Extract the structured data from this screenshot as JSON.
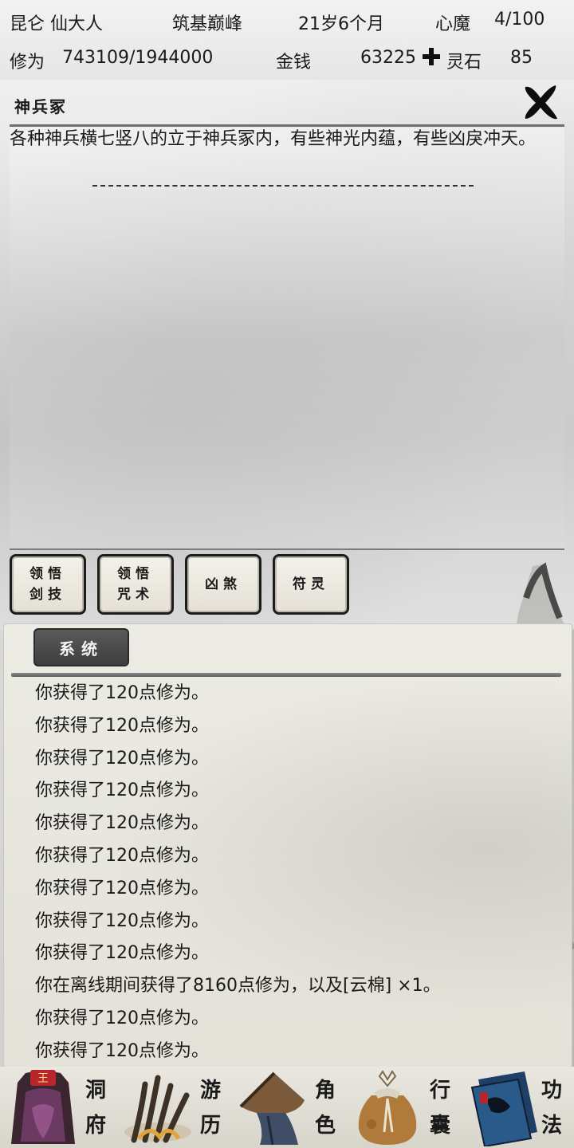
{
  "status": {
    "sect": "昆仑 仙大人",
    "realm": "筑基巅峰",
    "age": "21岁6个月",
    "heart_demon_label": "心魔",
    "heart_demon_value": "4/100",
    "cultivation_label": "修为",
    "cultivation_value": "743109/1944000",
    "money_label": "金钱",
    "money_value": "63225",
    "spirit_stone_label": "灵石",
    "spirit_stone_value": "85"
  },
  "event": {
    "title": "神兵冢",
    "description": "各种神兵横七竖八的立于神兵冢内，有些神光内蕴，有些凶戾冲天。",
    "actions": [
      {
        "line1": "领悟",
        "line2": "剑技"
      },
      {
        "line1": "领悟",
        "line2": "咒术"
      },
      {
        "line1": "凶煞",
        "line2": ""
      },
      {
        "line1": "符灵",
        "line2": ""
      }
    ]
  },
  "log": {
    "tab_label": "系统",
    "entries": [
      "你获得了120点修为。",
      "你获得了120点修为。",
      "你获得了120点修为。",
      "你获得了120点修为。",
      "你获得了120点修为。",
      "你获得了120点修为。",
      "你获得了120点修为。",
      "你获得了120点修为。",
      "你获得了120点修为。",
      "你在离线期间获得了8160点修为，以及[云棉] ×1。",
      "你获得了120点修为。",
      "你获得了120点修为。"
    ]
  },
  "nav": [
    {
      "char1": "洞",
      "char2": "府",
      "icon": "cave-dwelling-icon"
    },
    {
      "char1": "游",
      "char2": "历",
      "icon": "travel-icon"
    },
    {
      "char1": "角",
      "char2": "色",
      "icon": "character-icon"
    },
    {
      "char1": "行",
      "char2": "囊",
      "icon": "bag-icon"
    },
    {
      "char1": "功",
      "char2": "法",
      "icon": "skills-book-icon"
    }
  ],
  "nav_badge": "王",
  "colors": {
    "ink": "#1a1a1a",
    "tab": "#4a4a4a",
    "paper": "#e8e6dd",
    "accent_red": "#8b1a1a"
  }
}
